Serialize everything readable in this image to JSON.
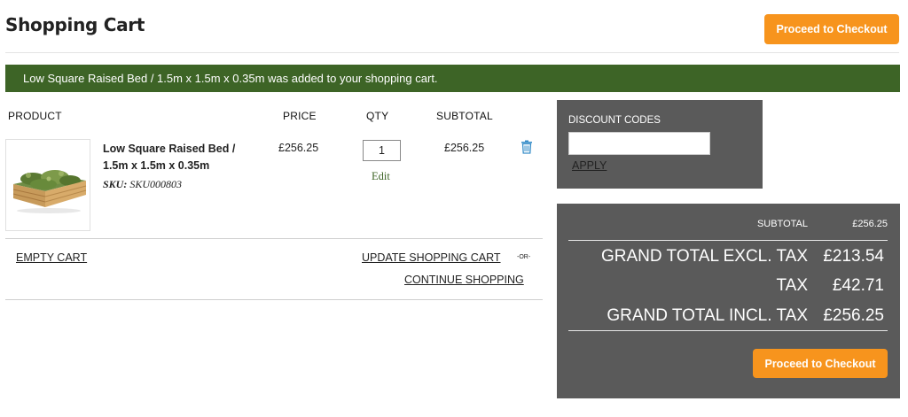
{
  "header": {
    "title": "Shopping Cart",
    "checkout_label": "Proceed to Checkout"
  },
  "notice": {
    "text": "Low Square Raised Bed / 1.5m x 1.5m x 0.35m was added to your shopping cart."
  },
  "cart": {
    "columns": {
      "product": "PRODUCT",
      "price": "PRICE",
      "qty": "QTY",
      "subtotal": "SUBTOTAL"
    },
    "items": [
      {
        "name": "Low Square Raised Bed / 1.5m x 1.5m x 0.35m",
        "sku_label": "SKU:",
        "sku": "SKU000803",
        "price": "£256.25",
        "qty": "1",
        "edit_label": "Edit",
        "subtotal": "£256.25",
        "remove_icon": "trash-icon"
      }
    ],
    "empty_label": "EMPTY CART",
    "update_label": "UPDATE SHOPPING CART",
    "or_label": "-OR-",
    "continue_label": "CONTINUE SHOPPING"
  },
  "discount": {
    "label": "DISCOUNT CODES",
    "input_value": "",
    "apply_label": "APPLY"
  },
  "totals": {
    "subtotal_label": "SUBTOTAL",
    "subtotal_value": "£256.25",
    "grand_excl_label": "GRAND TOTAL EXCL. TAX",
    "grand_excl_value": "£213.54",
    "tax_label": "TAX",
    "tax_value": "£42.71",
    "grand_incl_label": "GRAND TOTAL INCL. TAX",
    "grand_incl_value": "£256.25",
    "checkout_label": "Proceed to Checkout"
  },
  "colors": {
    "accent_orange": "#f7941d",
    "notice_green": "#3d6426",
    "panel_grey": "#5a5a5a",
    "trash_blue": "#3a8fc9"
  }
}
